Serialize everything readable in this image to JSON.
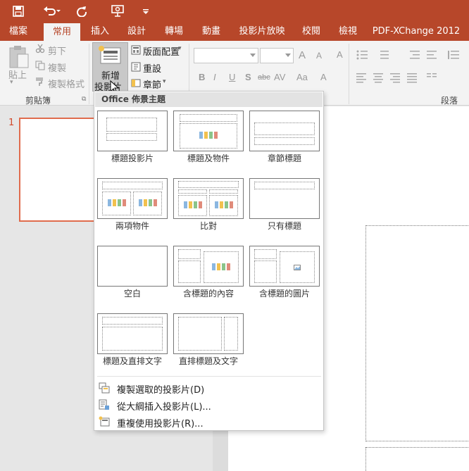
{
  "colors": {
    "brand": "#b7472a",
    "accent_thumb": "#e06c4d",
    "panel_header_bg": "#e3e3e3"
  },
  "quick_access": {
    "save_icon": "save-icon",
    "undo_icon": "undo-icon",
    "redo_icon": "redo-icon",
    "present_icon": "present-from-beginning-icon",
    "customize_icon": "customize-qat-icon"
  },
  "tabs": [
    {
      "label": "檔案"
    },
    {
      "label": "常用"
    },
    {
      "label": "插入"
    },
    {
      "label": "設計"
    },
    {
      "label": "轉場"
    },
    {
      "label": "動畫"
    },
    {
      "label": "投影片放映"
    },
    {
      "label": "校閱"
    },
    {
      "label": "檢視"
    },
    {
      "label": "PDF-XChange 2012"
    }
  ],
  "clipboard": {
    "paste": "貼上",
    "cut": "剪下",
    "copy": "複製",
    "format_painter": "複製格式",
    "group_label": "剪貼簿"
  },
  "slides": {
    "new_slide_line1": "新增",
    "new_slide_line2": "投影片",
    "layout": "版面配置",
    "reset": "重設",
    "section": "章節"
  },
  "font": {
    "bold": "B",
    "italic": "I",
    "underline": "U",
    "strike": "S",
    "abc": "abc",
    "spacing": "AV",
    "case": "Aa",
    "grow": "A",
    "shrink": "A",
    "clear": "A"
  },
  "paragraph": {
    "group_label": "段落"
  },
  "slide_panel": {
    "slide_number": "1"
  },
  "layout_gallery": {
    "header": "Office 佈景主題",
    "layouts": [
      {
        "name": "標題投影片"
      },
      {
        "name": "標題及物件"
      },
      {
        "name": "章節標題"
      },
      {
        "name": "兩項物件"
      },
      {
        "name": "比對"
      },
      {
        "name": "只有標題"
      },
      {
        "name": "空白"
      },
      {
        "name": "含標題的內容"
      },
      {
        "name": "含標題的圖片"
      },
      {
        "name": "標題及直排文字"
      },
      {
        "name": "直排標題及文字"
      }
    ],
    "menu": [
      {
        "label": "複製選取的投影片(D)",
        "icon": "duplicate-slides-icon"
      },
      {
        "label": "從大綱插入投影片(L)...",
        "icon": "outline-icon"
      },
      {
        "label": "重複使用投影片(R)...",
        "icon": "reuse-slides-icon"
      }
    ]
  }
}
